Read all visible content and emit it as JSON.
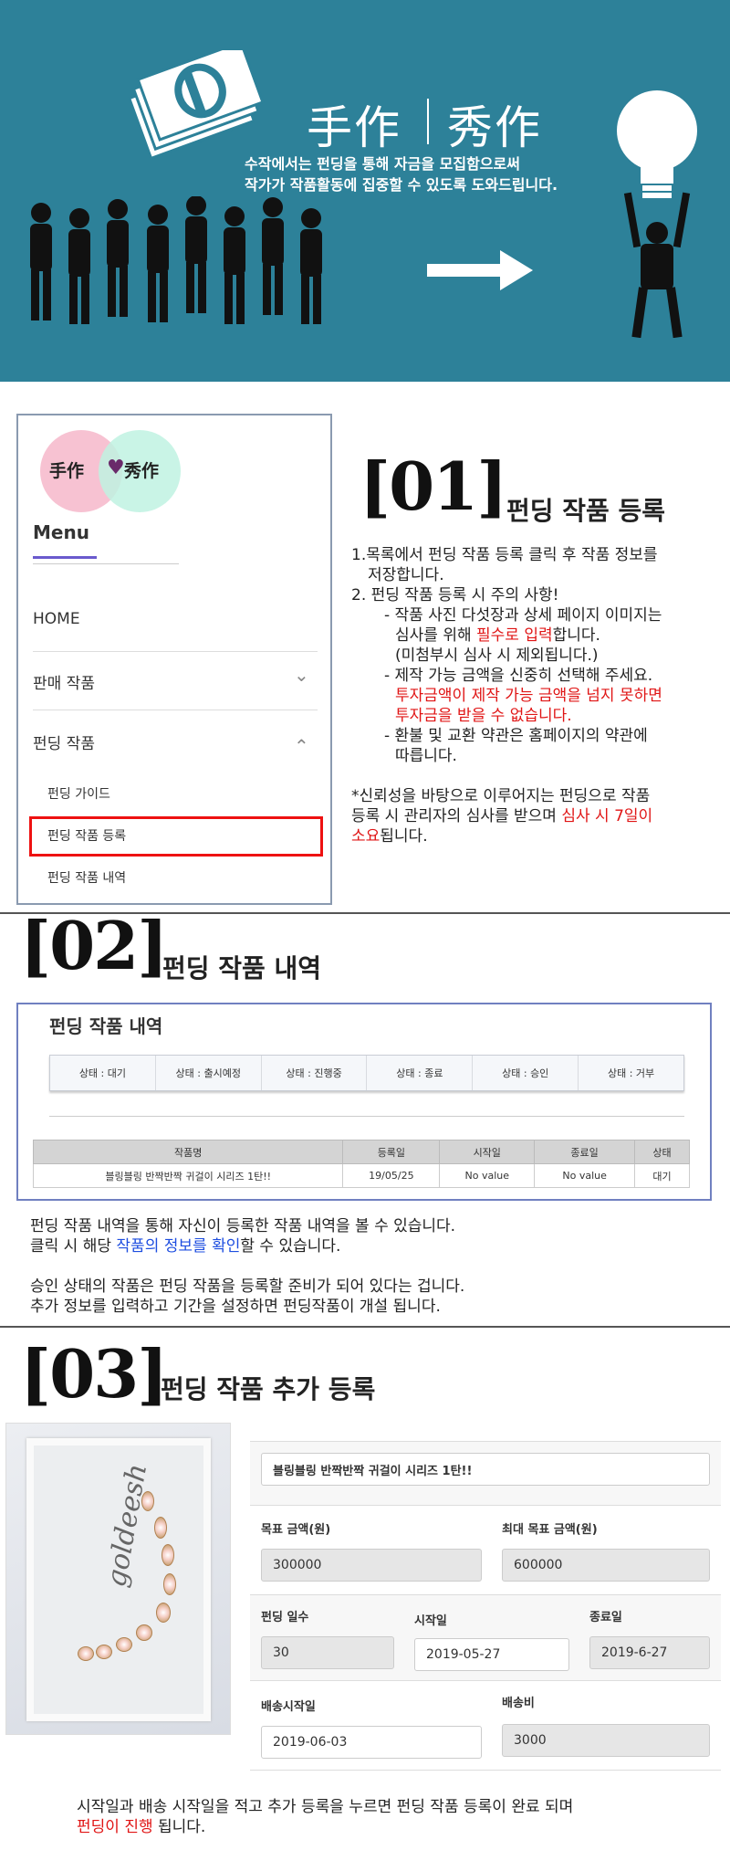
{
  "banner": {
    "title_left": "手作",
    "title_right": "秀作",
    "desc_line1": "수작에서는 펀딩을 통해 자금을 모집함으로써",
    "desc_line2": "작가가 작품활동에 집중할 수 있도록 도와드립니다."
  },
  "menu": {
    "logo_left": "手作",
    "logo_heart": "♥",
    "logo_right": "秀作",
    "heading": "Menu",
    "items": [
      {
        "label": "HOME"
      },
      {
        "label": "판매 작품",
        "chevron": "⌄"
      },
      {
        "label": "펀딩 작품",
        "chevron": "⌃"
      }
    ],
    "sub_items": [
      {
        "label": "펀딩 가이드"
      },
      {
        "label": "펀딩 작품 등록"
      },
      {
        "label": "펀딩 작품 내역"
      }
    ]
  },
  "sec1": {
    "num": "[01]",
    "title": "펀딩 작품 등록",
    "l1": "1.목록에서 펀딩 작품 등록 클릭 후 작품 정보를",
    "l2": "저장합니다.",
    "l3": "2. 펀딩 작품 등록 시 주의 사항!",
    "l4": "- 작품 사진 다섯장과 상세 페이지 이미지는",
    "l5a": "심사를 위해 ",
    "l5b": "필수로 입력",
    "l5c": "합니다.",
    "l6": "(미첨부시 심사 시 제외됩니다.)",
    "l7": "- 제작 가능 금액을 신중히 선택해 주세요.",
    "l8": "투자금액이 제작 가능 금액을 넘지 못하면",
    "l9": "투자금을 받을 수 없습니다.",
    "l10": "- 환불 및 교환 약관은 홈페이지의 약관에",
    "l11": "따릅니다.",
    "n1": "*신뢰성을 바탕으로 이루어지는 펀딩으로 작품",
    "n2a": "등록 시 관리자의 심사를 받으며 ",
    "n2b": "심사 시 7일이",
    "n3a": "소요",
    "n3b": "됩니다."
  },
  "sec2": {
    "num": "[02]",
    "title": "펀딩 작품 내역",
    "box_title": "펀딩 작품 내역",
    "tabs": [
      "상태 : 대기",
      "상태 : 출시예정",
      "상태 : 진행중",
      "상태 : 종료",
      "상태 : 승인",
      "상태 : 거부"
    ],
    "columns": [
      "작품명",
      "등록일",
      "시작일",
      "종료일",
      "상태"
    ],
    "row": [
      "블링블링 반짝반짝 귀걸이 시리즈 1탄!!",
      "19/05/25",
      "No value",
      "No value",
      "대기"
    ],
    "d1": "펀딩 작품 내역을 통해 자신이 등록한 작품 내역을 볼 수 있습니다.",
    "d2a": "클릭 시 해당 ",
    "d2b": "작품의 정보를 확인",
    "d2c": "할 수 있습니다.",
    "d3": "승인 상태의 작품은 펀딩 작품을 등록할 준비가 되어 있다는 겁니다.",
    "d4": "추가 정보를 입력하고 기간을 설정하면 펀딩작품이 개설 됩니다."
  },
  "sec3": {
    "num": "[03]",
    "title": "펀딩 작품 추가 등록",
    "image_script": "goldeesh",
    "product_name": "블링블링 반짝반짝 귀걸이 시리즈 1탄!!",
    "goal_label": "목표 금액(원)",
    "goal": "300000",
    "max_label": "최대 목표 금액(원)",
    "max": "600000",
    "days_label": "펀딩 일수",
    "days": "30",
    "start_label": "시작일",
    "start": "2019-05-27",
    "end_label": "종료일",
    "end": "2019-6-27",
    "ship_label": "배송시작일",
    "ship": "2019-06-03",
    "fee_label": "배송비",
    "fee": "3000",
    "f1": "시작일과 배송 시작일을 적고 추가 등록을 누르면 펀딩 작품 등록이 완료 되며",
    "f2a": "펀딩이 진행",
    "f2b": " 됩니다."
  }
}
